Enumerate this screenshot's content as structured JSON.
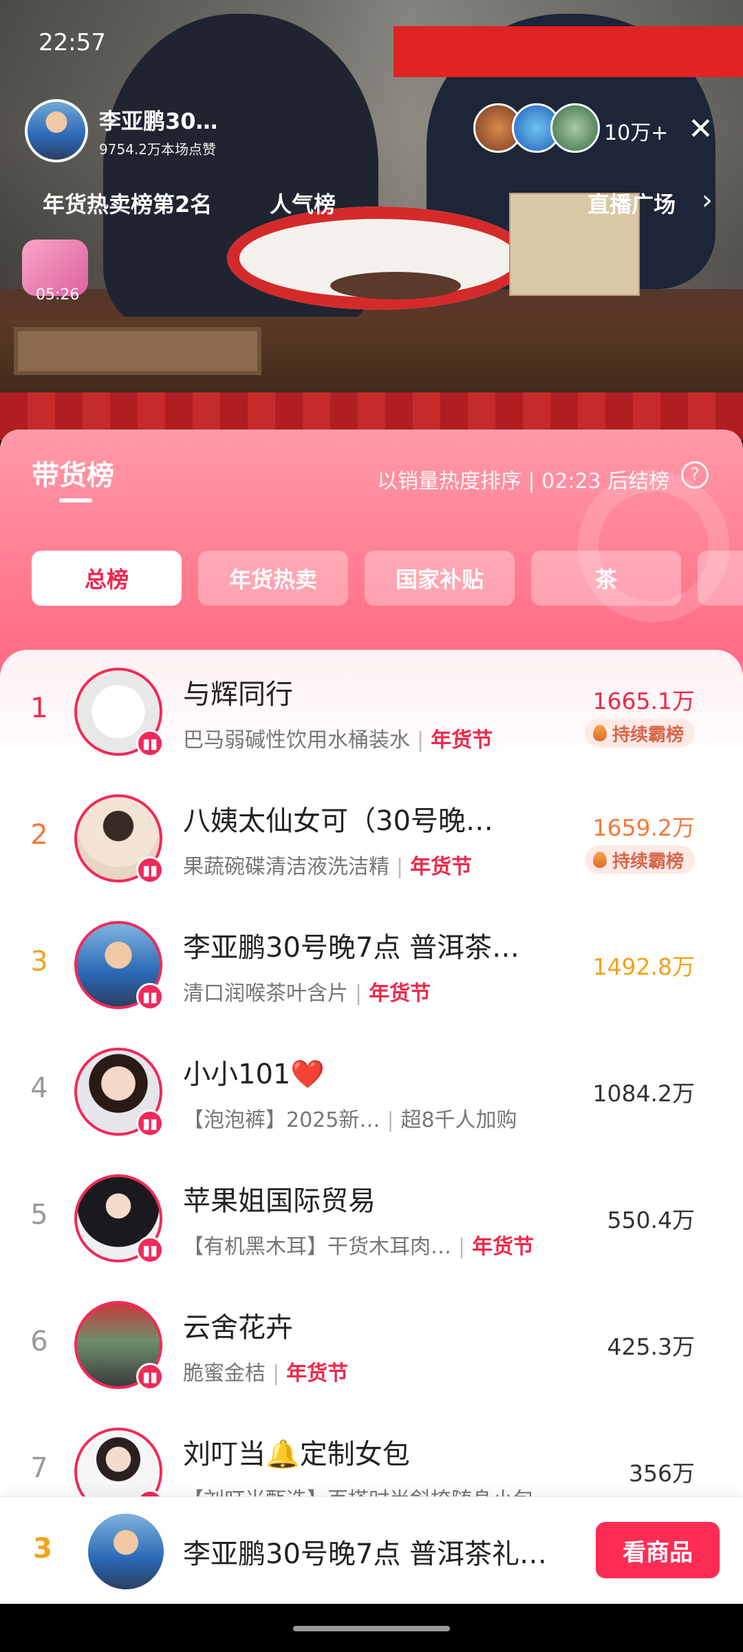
{
  "status": {
    "time": "22:57"
  },
  "stream": {
    "host_name": "李亚鹏30…",
    "host_likes": "9754.2万本场点赞",
    "viewer_count": "10万+",
    "tag_rank": "年货热卖榜第2名",
    "tag_popularity": "人气榜",
    "tag_live_plaza": "直播广场",
    "gift_timer": "05:26"
  },
  "panel": {
    "title": "带货榜",
    "sort_info": "以销量热度排序 | 02:23 后结榜",
    "help_glyph": "?",
    "tabs": [
      {
        "label": "总榜",
        "active": true
      },
      {
        "label": "年货热卖",
        "active": false
      },
      {
        "label": "国家补贴",
        "active": false
      },
      {
        "label": "茶",
        "active": false
      }
    ]
  },
  "ranking": [
    {
      "rank": "1",
      "name": "与辉同行",
      "product": "巴马弱碱性饮用水桶装水",
      "tag": "年货节",
      "value": "1665.1万",
      "badge": "持续霸榜",
      "rank_color": "#f0284a",
      "value_color": "#f0284a"
    },
    {
      "rank": "2",
      "name": "八姨太仙女可（30号晚…",
      "product": "果蔬碗碟清洁液洗洁精",
      "tag": "年货节",
      "value": "1659.2万",
      "badge": "持续霸榜",
      "rank_color": "#f5783a",
      "value_color": "#f5783a"
    },
    {
      "rank": "3",
      "name": "李亚鹏30号晚7点 普洱茶…",
      "product": "清口润喉茶叶含片",
      "tag": "年货节",
      "value": "1492.8万",
      "badge": "",
      "rank_color": "#f2a31a",
      "value_color": "#f2a31a"
    },
    {
      "rank": "4",
      "name": "小小101❤️",
      "product": "【泡泡裤】2025新…",
      "tag": "超8千人加购",
      "value": "1084.2万",
      "badge": "",
      "rank_color": "#999999",
      "value_color": "#333333"
    },
    {
      "rank": "5",
      "name": "苹果姐国际贸易",
      "product": "【有机黑木耳】干货木耳肉…",
      "tag": "年货节",
      "value": "550.4万",
      "badge": "",
      "rank_color": "#999999",
      "value_color": "#333333"
    },
    {
      "rank": "6",
      "name": "云舍花卉",
      "product": "脆蜜金桔",
      "tag": "年货节",
      "value": "425.3万",
      "badge": "",
      "rank_color": "#999999",
      "value_color": "#333333"
    },
    {
      "rank": "7",
      "name": "刘叮当🔔定制女包",
      "product": "【刘叮当甄选】百搭时尚斜挎随身小包",
      "tag": "",
      "value": "356万",
      "badge": "",
      "rank_color": "#999999",
      "value_color": "#333333"
    }
  ],
  "bottom_bar": {
    "rank": "3",
    "title": "李亚鹏30号晚7点 普洱茶礼…",
    "button": "看商品"
  },
  "colors": {
    "accent": "#fe2c55",
    "festival_tag": "#f0284a",
    "panel_gradient_top": "#ff9aa8"
  }
}
